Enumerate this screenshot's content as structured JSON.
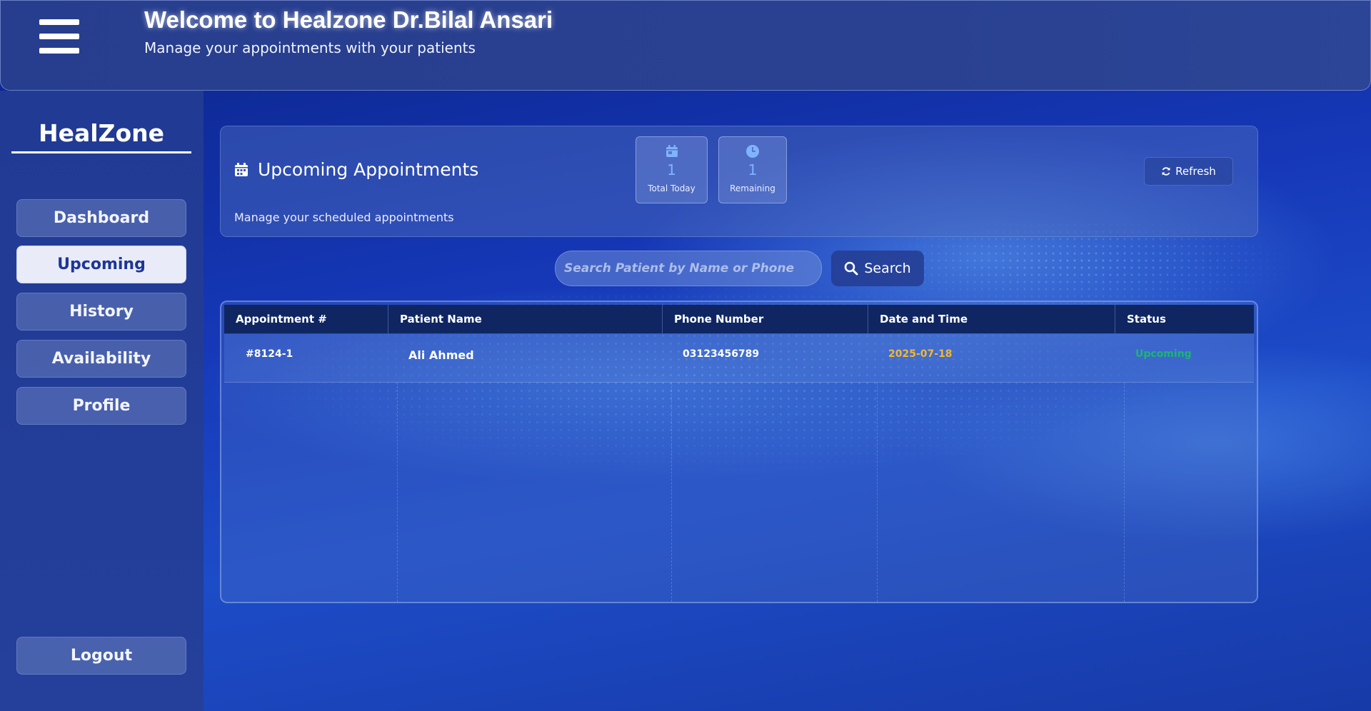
{
  "header": {
    "title": "Welcome to Healzone Dr.Bilal Ansari",
    "subtitle": "Manage your appointments with your patients"
  },
  "sidebar": {
    "brand": "HealZone",
    "items": [
      {
        "label": "Dashboard",
        "active": false
      },
      {
        "label": "Upcoming",
        "active": true
      },
      {
        "label": "History",
        "active": false
      },
      {
        "label": "Availability",
        "active": false
      },
      {
        "label": "Profile",
        "active": false
      }
    ],
    "logout_label": "Logout"
  },
  "panel": {
    "title": "Upcoming Appointments",
    "subtitle": "Manage your scheduled appointments",
    "stats": [
      {
        "icon": "calendar-icon",
        "value": "1",
        "label": "Total Today"
      },
      {
        "icon": "clock-icon",
        "value": "1",
        "label": "Remaining"
      }
    ],
    "refresh_label": "Refresh"
  },
  "search": {
    "placeholder": "Search Patient by Name or Phone",
    "button_label": "Search"
  },
  "table": {
    "columns": [
      "Appointment #",
      "Patient Name",
      "Phone Number",
      "Date and Time",
      "Status"
    ],
    "rows": [
      {
        "id": "#8124-1",
        "name": "Ali Ahmed",
        "phone": "03123456789",
        "date": "2025-07-18",
        "status": "Upcoming"
      }
    ]
  },
  "colors": {
    "date": "#f5b72b",
    "status_upcoming": "#1bb673",
    "stat_number": "#7fb3ff",
    "table_header": "#0f2662"
  }
}
